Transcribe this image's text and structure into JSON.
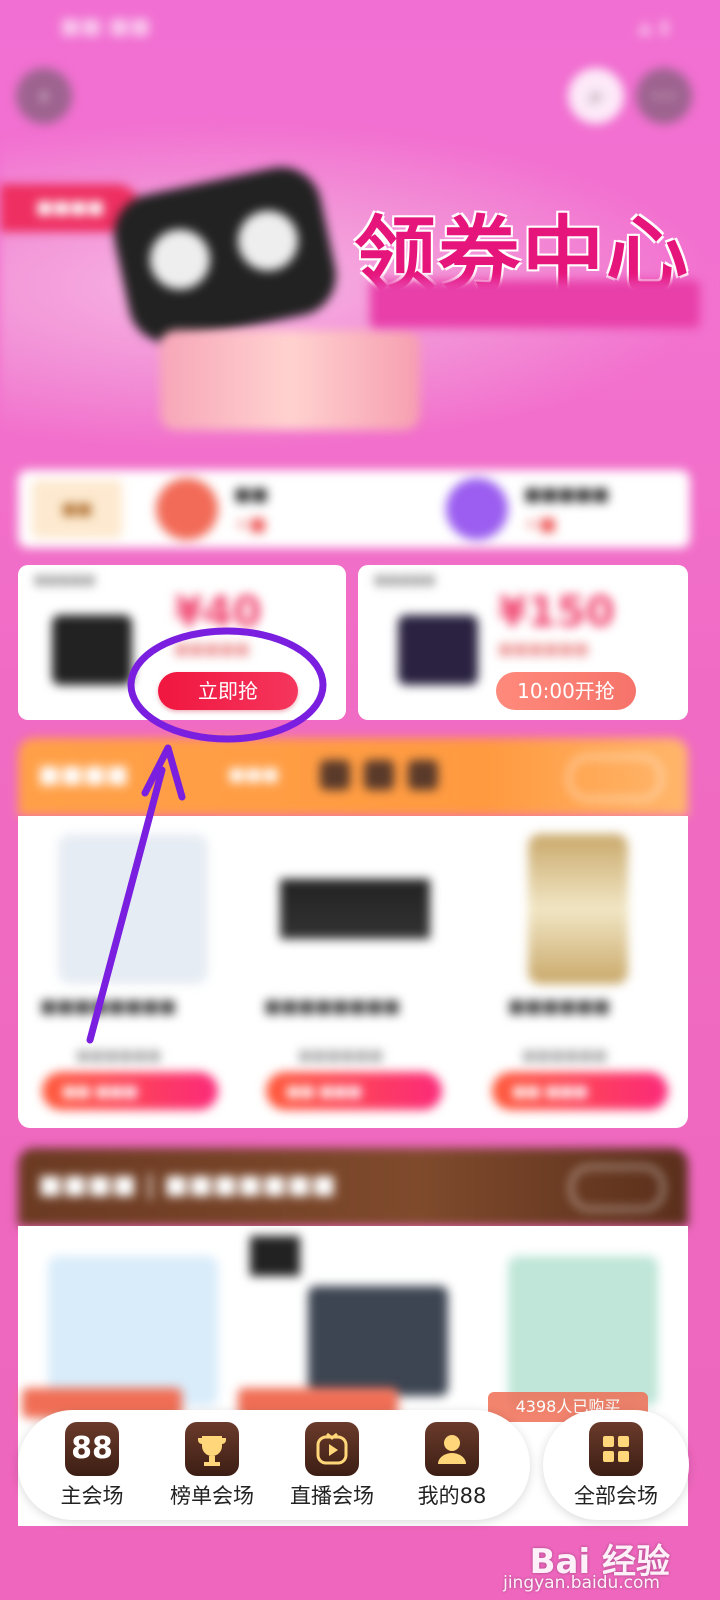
{
  "coupon_cards": [
    {
      "amount": "¥40",
      "button_label": "立即抢"
    },
    {
      "amount": "¥150",
      "button_label": "10:00开抢"
    }
  ],
  "banner": {
    "title": "领券中心"
  },
  "bottom_nav": {
    "items": [
      {
        "icon_text": "88",
        "label": "主会场"
      },
      {
        "label": "榜单会场"
      },
      {
        "label": "直播会场"
      },
      {
        "label": "我的88"
      }
    ],
    "all_label": "全部会场"
  },
  "brand_section": {
    "badge": "4398人已购买"
  },
  "watermark": {
    "logo": "Bai 经验",
    "url": "jingyan.baidu.com"
  },
  "colors": {
    "accent_pink": "#e6157b",
    "grab_button": "#f0163f",
    "annotation_purple": "#7a1ee0",
    "flash_orange": "#ffa048",
    "brand_brown": "#6b3a22"
  }
}
